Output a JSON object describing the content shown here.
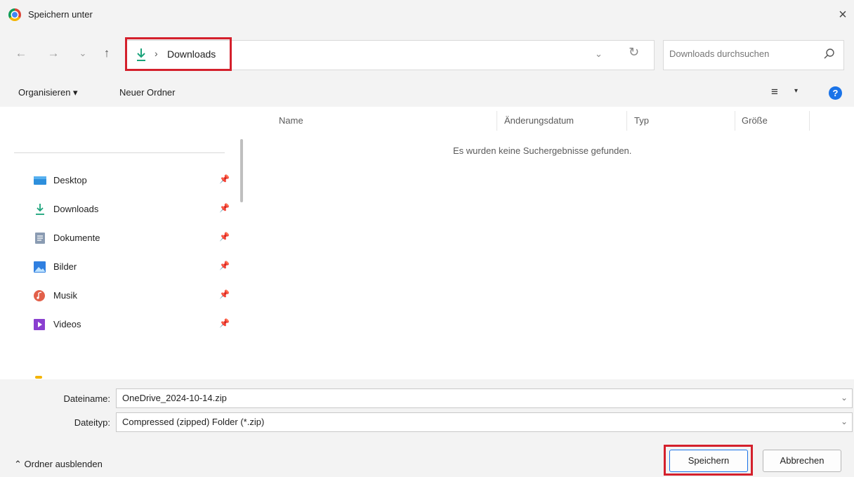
{
  "window": {
    "title": "Speichern unter",
    "close": "×"
  },
  "nav": {
    "back": "←",
    "forward": "→",
    "recent": "⌄",
    "up": "↑"
  },
  "address": {
    "separator": "›",
    "current": "Downloads",
    "dropdown": "⌄",
    "refresh": "↻"
  },
  "search": {
    "placeholder": "Downloads durchsuchen"
  },
  "toolbar": {
    "organize": "Organisieren ▾",
    "new_folder": "Neuer Ordner",
    "view": "≡",
    "view_dd": "▾",
    "help": "?"
  },
  "sidebar": {
    "items": [
      {
        "label": "Desktop",
        "icon": "desktop-icon",
        "color": "#2d8fdc"
      },
      {
        "label": "Downloads",
        "icon": "download-icon",
        "color": "#1aa37a"
      },
      {
        "label": "Dokumente",
        "icon": "document-icon",
        "color": "#8a9bb2"
      },
      {
        "label": "Bilder",
        "icon": "pictures-icon",
        "color": "#2f7fe0"
      },
      {
        "label": "Musik",
        "icon": "music-icon",
        "color": "#e2604a"
      },
      {
        "label": "Videos",
        "icon": "videos-icon",
        "color": "#8a3fd0"
      }
    ],
    "pin": "📌"
  },
  "columns": [
    "Name",
    "Änderungsdatum",
    "Typ",
    "Größe"
  ],
  "empty_message": "Es wurden keine Suchergebnisse gefunden.",
  "fields": {
    "filename_label": "Dateiname:",
    "filename_value": "OneDrive_2024-10-14.zip",
    "filetype_label": "Dateityp:",
    "filetype_value": "Compressed (zipped) Folder (*.zip)",
    "dropdown": "⌄"
  },
  "footer": {
    "hide_folders": "⌃  Ordner ausblenden",
    "save": "Speichern",
    "cancel": "Abbrechen"
  },
  "colors": {
    "highlight": "#d4202c",
    "accent": "#1a73e8"
  }
}
